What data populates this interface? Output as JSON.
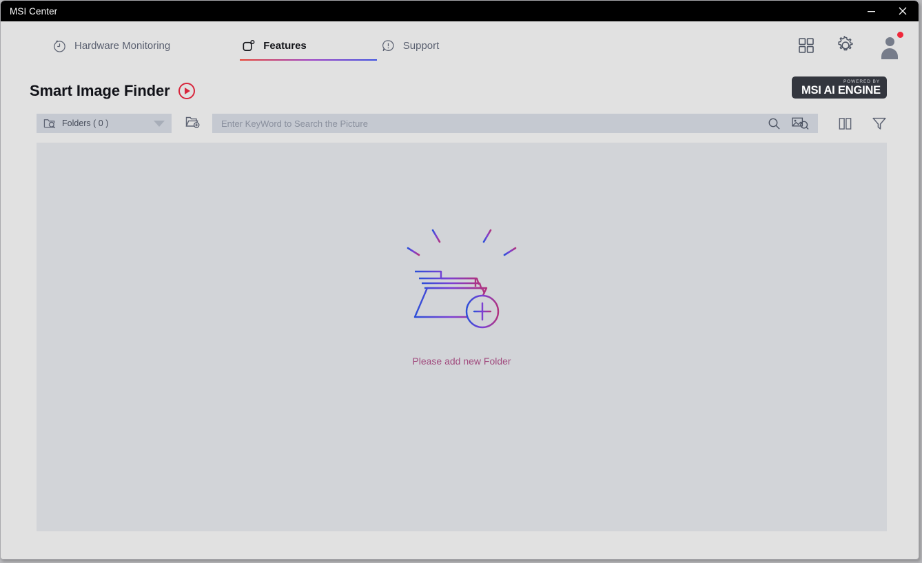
{
  "window": {
    "title": "MSI Center",
    "controls": [
      {
        "name": "minimize",
        "glyph": "minimize-icon"
      },
      {
        "name": "close",
        "glyph": "close-icon"
      }
    ]
  },
  "nav": {
    "tabs": [
      {
        "id": "hardware-monitoring",
        "label": "Hardware Monitoring",
        "icon": "stopwatch-icon",
        "active": false
      },
      {
        "id": "features",
        "label": "Features",
        "icon": "rounded-square-dot-icon",
        "active": true
      },
      {
        "id": "support",
        "label": "Support",
        "icon": "speech-bubble-alert-icon",
        "active": false
      }
    ],
    "right_icons": [
      {
        "name": "apps-grid-icon"
      },
      {
        "name": "gear-icon"
      },
      {
        "name": "avatar",
        "has_notification": true
      }
    ],
    "active_underline_gradient": [
      "#e8402f",
      "#9b3dc4",
      "#3b4fe0"
    ]
  },
  "header": {
    "title": "Smart Image Finder",
    "play_button": "play-icon",
    "ai_badge": {
      "powered_by": "POWERED BY",
      "engine": "MSI AI ENGINE"
    }
  },
  "toolbar": {
    "folders_label": "Folders ( 0 )",
    "folders_icon": "folder-search-icon",
    "dropdown_icon": "chevron-down-icon",
    "add_folder_icon": "add-folder-icon",
    "search": {
      "value": "",
      "placeholder": "Enter KeyWord to Search the Picture"
    },
    "search_icons": [
      {
        "name": "search-icon"
      },
      {
        "name": "image-search-icon"
      }
    ],
    "view_icons": [
      {
        "name": "split-view-icon"
      },
      {
        "name": "filter-funnel-icon"
      }
    ]
  },
  "content": {
    "empty_state": {
      "illustration": "add-folder-illustration",
      "caption": "Please add new Folder",
      "caption_color": "#a14b7e",
      "gradient_start": "#2b4fd8",
      "gradient_mid": "#7b3fd4",
      "gradient_end": "#b0327e"
    }
  },
  "colors": {
    "page_background": "#e1e1e1",
    "panel_background": "#d2d4d8",
    "titlebar": "#000000",
    "accent_red": "#d8253c",
    "control_fill": "#c5c9d1"
  }
}
